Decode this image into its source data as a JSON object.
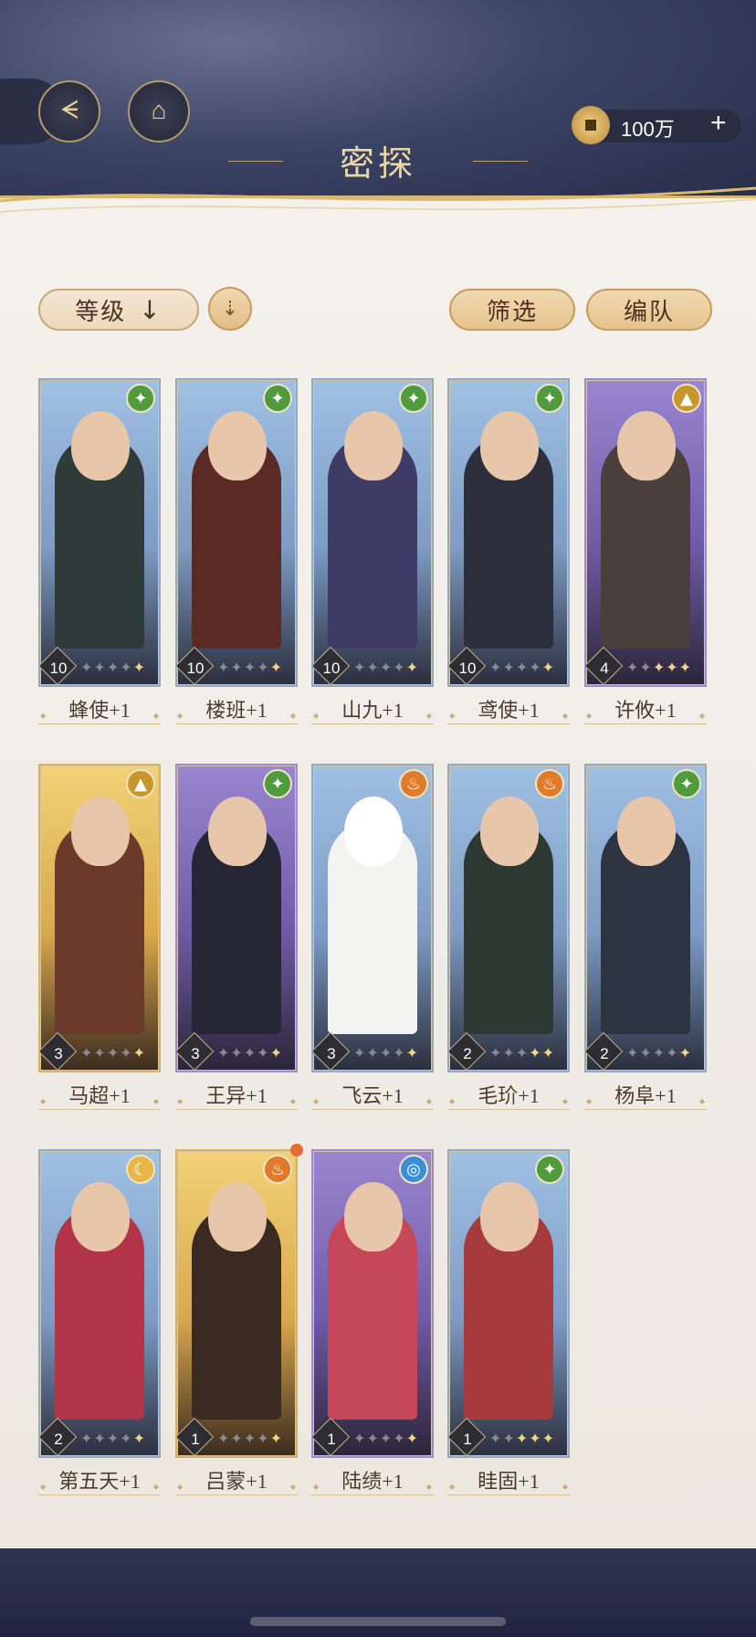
{
  "header": {
    "title": "密探",
    "back_icon": "back-arrow-icon",
    "home_icon": "pagoda-icon",
    "currency": {
      "icon": "coin-icon",
      "value": "100万",
      "add": "+"
    }
  },
  "toolbar": {
    "sort_label": "等级",
    "sort_arrow": "↓",
    "sort_toggle": "⇣",
    "filter_label": "筛选",
    "team_label": "编队"
  },
  "cards": [
    {
      "name": "蜂使+1",
      "level": "10",
      "element": "green",
      "elem_glyph": "✦",
      "bg": "blue",
      "stars_on": 1,
      "stars_total": 5
    },
    {
      "name": "楼班+1",
      "level": "10",
      "element": "green",
      "elem_glyph": "✦",
      "bg": "blue",
      "stars_on": 1,
      "stars_total": 5
    },
    {
      "name": "山九+1",
      "level": "10",
      "element": "green",
      "elem_glyph": "✦",
      "bg": "blue",
      "stars_on": 1,
      "stars_total": 5
    },
    {
      "name": "鸢使+1",
      "level": "10",
      "element": "green",
      "elem_glyph": "✦",
      "bg": "blue",
      "stars_on": 1,
      "stars_total": 5
    },
    {
      "name": "许攸+1",
      "level": "4",
      "element": "gold",
      "elem_glyph": "▲",
      "bg": "purple",
      "stars_on": 3,
      "stars_total": 5
    },
    {
      "name": "马超+1",
      "level": "3",
      "element": "gold",
      "elem_glyph": "▲",
      "bg": "gold",
      "stars_on": 1,
      "stars_total": 5
    },
    {
      "name": "王异+1",
      "level": "3",
      "element": "green",
      "elem_glyph": "✦",
      "bg": "purple",
      "stars_on": 1,
      "stars_total": 5
    },
    {
      "name": "飞云+1",
      "level": "3",
      "element": "orange",
      "elem_glyph": "♨",
      "bg": "blue",
      "stars_on": 1,
      "stars_total": 5
    },
    {
      "name": "毛玠+1",
      "level": "2",
      "element": "orange",
      "elem_glyph": "♨",
      "bg": "blue",
      "stars_on": 2,
      "stars_total": 5
    },
    {
      "name": "杨阜+1",
      "level": "2",
      "element": "green",
      "elem_glyph": "✦",
      "bg": "blue",
      "stars_on": 1,
      "stars_total": 5
    },
    {
      "name": "第五天+1",
      "level": "2",
      "element": "yellow",
      "elem_glyph": "☾",
      "bg": "blue",
      "stars_on": 1,
      "stars_total": 5
    },
    {
      "name": "吕蒙+1",
      "level": "1",
      "element": "orange",
      "elem_glyph": "♨",
      "bg": "gold",
      "stars_on": 1,
      "stars_total": 5,
      "notify": true
    },
    {
      "name": "陆绩+1",
      "level": "1",
      "element": "blue",
      "elem_glyph": "◎",
      "bg": "purple",
      "stars_on": 1,
      "stars_total": 5
    },
    {
      "name": "眭固+1",
      "level": "1",
      "element": "green",
      "elem_glyph": "✦",
      "bg": "blue",
      "stars_on": 3,
      "stars_total": 5
    }
  ],
  "colors": {
    "accent_gold": "#c79b5d",
    "paper": "#f4f1ec",
    "night": "#2c3352"
  }
}
